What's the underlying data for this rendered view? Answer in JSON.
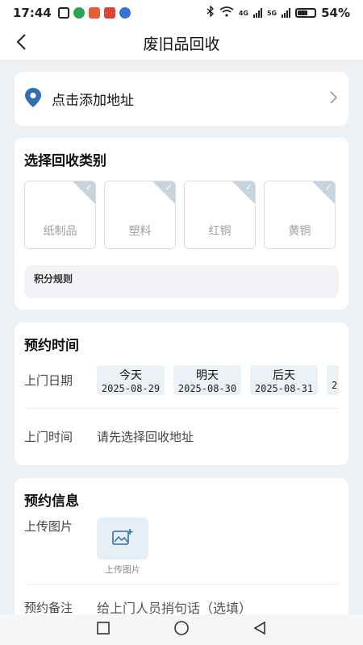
{
  "status_bar": {
    "time": "17:44",
    "network_4g": "4G",
    "network_5g": "5G",
    "battery_percent": "54%",
    "battery_level": 0.54
  },
  "navbar": {
    "title": "废旧品回收"
  },
  "address": {
    "label": "点击添加地址"
  },
  "categories": {
    "title": "选择回收类别",
    "items": [
      {
        "label": "纸制品"
      },
      {
        "label": "塑料"
      },
      {
        "label": "红铜"
      },
      {
        "label": "黄铜"
      }
    ],
    "rules_label": "积分规则"
  },
  "schedule": {
    "title": "预约时间",
    "date_label": "上门日期",
    "dates": [
      {
        "day": "今天",
        "date": "2025-08-29"
      },
      {
        "day": "明天",
        "date": "2025-08-30"
      },
      {
        "day": "后天",
        "date": "2025-08-31"
      },
      {
        "day": "",
        "date": "2"
      }
    ],
    "time_label": "上门时间",
    "time_placeholder": "请先选择回收地址"
  },
  "info": {
    "title": "预约信息",
    "upload_label": "上传图片",
    "upload_button_label": "上传图片",
    "note_label": "预约备注",
    "note_placeholder": "给上门人员捎句话（选填）"
  },
  "colors": {
    "accent": "#2f6fb0",
    "chip_bg": "#eaf1f7",
    "page_bg": "#eef1f4"
  }
}
